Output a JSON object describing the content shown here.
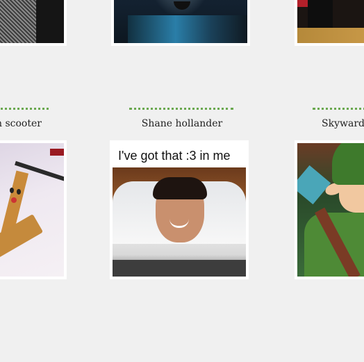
{
  "captions": {
    "left": "n scooter",
    "middle": "Shane hollander",
    "right": "Skyward s"
  },
  "meme": {
    "text": "I've got that :3 in me"
  },
  "colors": {
    "background": "#f0f0f0",
    "dotted_separator": "#6aa84f",
    "frame": "#ffffff"
  }
}
